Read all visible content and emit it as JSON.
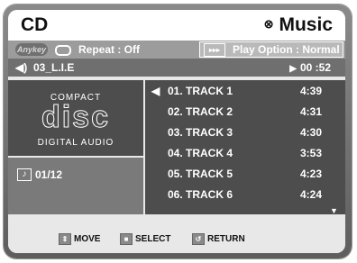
{
  "header": {
    "title": "CD",
    "mode": "Music",
    "mode_icon": "disc-icon"
  },
  "info_bar": {
    "anykey": "Anykey",
    "repeat": "Repeat : Off",
    "play_option": "Play Option : Normal"
  },
  "status_bar": {
    "file": "03_L.I.E",
    "time": "00 :52"
  },
  "cd_logo": {
    "compact": "COMPACT",
    "disc": "disc",
    "digital_audio": "DIGITAL AUDIO"
  },
  "track_count": "01/12",
  "tracks": [
    {
      "name": "01. TRACK 1",
      "duration": "4:39",
      "playing": true
    },
    {
      "name": "02. TRACK 2",
      "duration": "4:31"
    },
    {
      "name": "03. TRACK 3",
      "duration": "4:30"
    },
    {
      "name": "04. TRACK 4",
      "duration": "3:53"
    },
    {
      "name": "05. TRACK 5",
      "duration": "4:23"
    },
    {
      "name": "06. TRACK 6",
      "duration": "4:24"
    }
  ],
  "footer": {
    "move": "MOVE",
    "select": "SELECT",
    "return": "RETURN"
  }
}
